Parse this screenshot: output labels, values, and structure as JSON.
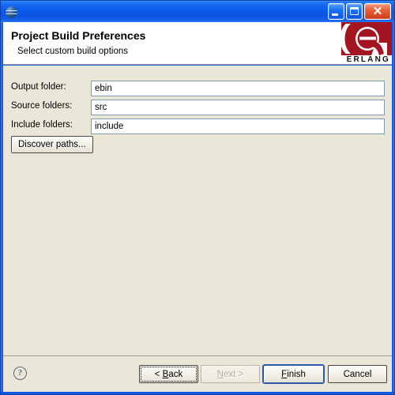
{
  "window": {
    "title": "",
    "icon": "eclipse-sphere-icon",
    "controls": {
      "minimize": "minimize-icon",
      "maximize": "maximize-icon",
      "close": "✕"
    }
  },
  "header": {
    "title": "Project Build Preferences",
    "subtitle": "Select custom build options",
    "logo": {
      "wordmark": "ERLANG",
      "mark_color": "#a31621",
      "glyph": "(e)"
    }
  },
  "form": {
    "fields": [
      {
        "label": "Output folder:",
        "value": "ebin",
        "placeholder": ""
      },
      {
        "label": "Source folders:",
        "value": "src",
        "placeholder": ""
      },
      {
        "label": "Include folders:",
        "value": "include",
        "placeholder": ""
      }
    ],
    "discover_button": "Discover paths..."
  },
  "footer": {
    "help_icon": "?",
    "buttons": [
      {
        "name": "back",
        "prefix": "< ",
        "mnemonic": "B",
        "suffix": "ack",
        "state": "focused"
      },
      {
        "name": "next",
        "prefix": "",
        "mnemonic": "N",
        "suffix": "ext >",
        "state": "disabled"
      },
      {
        "name": "finish",
        "prefix": "",
        "mnemonic": "F",
        "suffix": "inish",
        "state": "default"
      },
      {
        "name": "cancel",
        "prefix": "",
        "mnemonic": "",
        "suffix": "Cancel",
        "state": "normal"
      }
    ]
  },
  "colors": {
    "titlebar_blue": "#0a5bec",
    "body_beige": "#eae7d8",
    "close_red": "#cf3a18",
    "erlang_red": "#a31621",
    "field_border": "#7b9bb5"
  }
}
